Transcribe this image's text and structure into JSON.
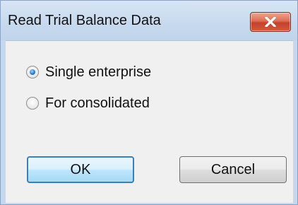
{
  "dialog": {
    "title": "Read Trial Balance Data",
    "close_icon": "close-icon",
    "options": [
      {
        "label": "Single enterprise",
        "selected": true
      },
      {
        "label": "For consolidated",
        "selected": false
      }
    ],
    "ok_label": "OK",
    "cancel_label": "Cancel"
  },
  "colors": {
    "titlebar": "#c7d9ee",
    "close_button": "#c4412b",
    "client_background": "#f0f0f0",
    "default_button_border": "#3c7fb1"
  }
}
